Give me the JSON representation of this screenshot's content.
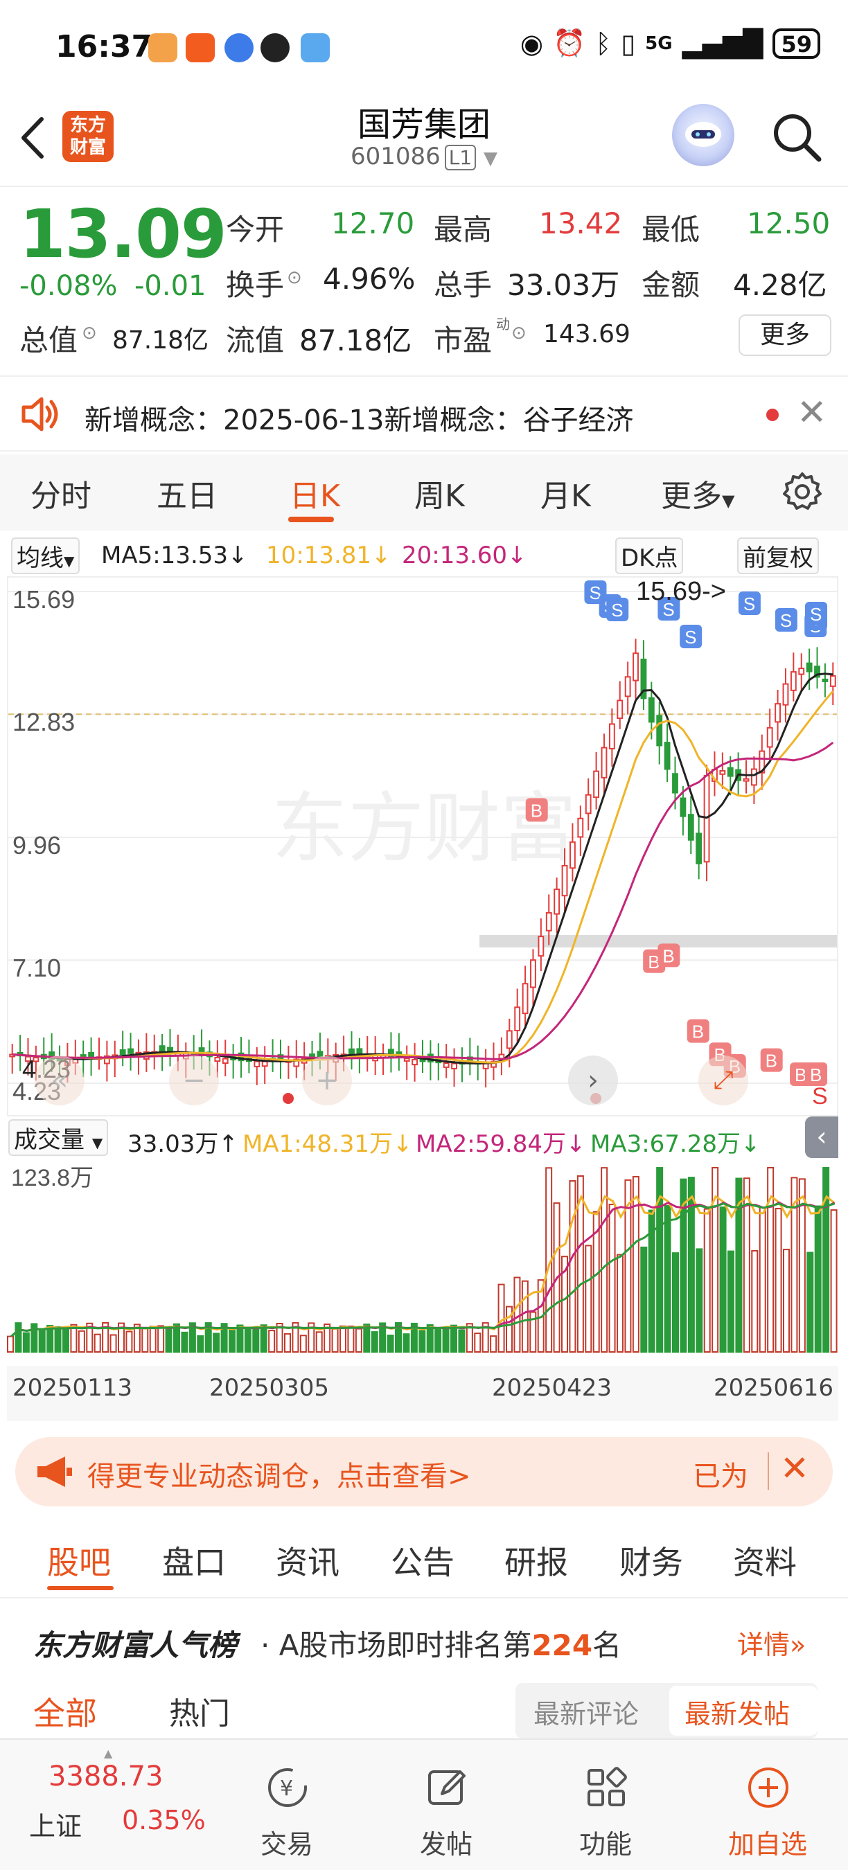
{
  "status": {
    "time": "16:37",
    "network": "5G",
    "battery": "59"
  },
  "header": {
    "logo_text": "东方\n财富",
    "name": "国芳集团",
    "code": "601086",
    "level": "L1"
  },
  "quote": {
    "price": "13.09",
    "change_pct": "-0.08%",
    "change": "-0.01",
    "open_label": "今开",
    "open": "12.70",
    "high_label": "最高",
    "high": "13.42",
    "low_label": "最低",
    "low": "12.50",
    "turnover_label": "换手",
    "turnover": "4.96%",
    "volume_label": "总手",
    "volume": "33.03万",
    "amount_label": "金额",
    "amount": "4.28亿",
    "mktcap_label": "总值",
    "mktcap": "87.18亿",
    "float_label": "流值",
    "float": "87.18亿",
    "pe_label": "市盈",
    "pe_sup": "动",
    "pe": "143.69",
    "more": "更多"
  },
  "notice": {
    "text": "新增概念：2025-06-13新增概念：谷子经济"
  },
  "period_tabs": [
    "分时",
    "五日",
    "日K",
    "周K",
    "月K",
    "更多"
  ],
  "active_period": "日K",
  "ma": {
    "selector": "均线",
    "ma5": "MA5:13.53↓",
    "ma10": "10:13.81↓",
    "ma20": "20:13.60↓",
    "dk": "DK点",
    "adjust": "前复权",
    "colors": {
      "ma5": "#222222",
      "ma10": "#f0b429",
      "ma20": "#c4267a"
    }
  },
  "chart_data": {
    "type": "candlestick",
    "y_ticks": [
      "15.69",
      "12.83",
      "9.96",
      "7.10",
      "4.23"
    ],
    "ylim": [
      4.23,
      15.69
    ],
    "high_marker": "15.69->",
    "low_marker": "4.23",
    "signal_s": "S",
    "signal_b": "B",
    "x_dates": [
      "20250113",
      "20250305",
      "20250423",
      "20250616"
    ],
    "volume": {
      "selector": "成交量",
      "current": "33.03万↑",
      "ma1": "MA1:48.31万↓",
      "ma2": "MA2:59.84万↓",
      "ma3": "MA3:67.28万↓",
      "max_label": "123.8万"
    }
  },
  "promo": {
    "text": "得更专业动态调仓，点击查看>",
    "right": "已为"
  },
  "content_tabs": [
    "股吧",
    "盘口",
    "资讯",
    "公告",
    "研报",
    "财务",
    "资料"
  ],
  "ranking": {
    "title": "东方财富人气榜",
    "text_prefix": "· A股市场即时排名第",
    "rank": "224",
    "text_suffix": "名",
    "detail": "详情"
  },
  "sub_tabs": {
    "all": "全部",
    "hot": "热门",
    "latest_comment": "最新评论",
    "latest_post": "最新发帖"
  },
  "bottom_nav": {
    "index_value": "3388.73",
    "index_name": "上证",
    "index_change": "0.35%",
    "items": [
      "交易",
      "发帖",
      "功能",
      "加自选"
    ]
  }
}
